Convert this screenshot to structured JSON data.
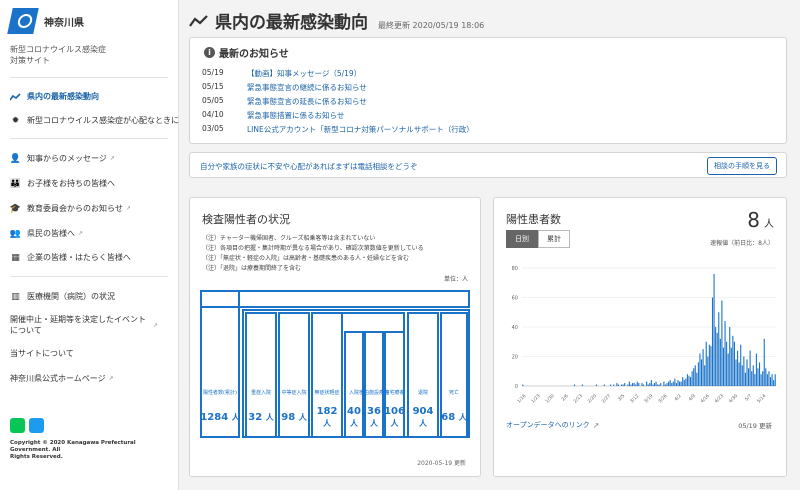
{
  "sidebar": {
    "logo_text": "神奈川県",
    "site_name_line1": "新型コロナウイルス感染症",
    "site_name_line2": "対策サイト",
    "nav_primary": [
      {
        "label": "県内の最新感染動向",
        "icon": "trend-icon",
        "active": true
      },
      {
        "label": "新型コロナウイルス感染症が心配なときに",
        "icon": "virus-icon",
        "active": false
      }
    ],
    "nav_secondary": [
      {
        "label": "知事からのメッセージ",
        "icon": "person-icon",
        "external": true
      },
      {
        "label": "お子様をお持ちの皆様へ",
        "icon": "family-icon",
        "external": false
      },
      {
        "label": "教育委員会からのお知らせ",
        "icon": "graduation-cap-icon",
        "external": true
      },
      {
        "label": "県民の皆様へ",
        "icon": "group-icon",
        "external": true
      },
      {
        "label": "企業の皆様・はたらく皆様へ",
        "icon": "building-icon",
        "external": false
      }
    ],
    "nav_tertiary": [
      {
        "label": "医療機関（病院）の状況",
        "icon": "hospital-icon",
        "external": false
      },
      {
        "label": "開催中止・延期等を決定したイベントについて",
        "icon": "",
        "external": true
      },
      {
        "label": "当サイトについて",
        "icon": "",
        "external": false
      },
      {
        "label": "神奈川県公式ホームページ",
        "icon": "",
        "external": true
      }
    ],
    "copyright_line1": "Copyright © 2020 Kanagawa Prefectural Government. All",
    "copyright_line2": "Rights Reserved."
  },
  "header": {
    "title": "県内の最新感染動向",
    "updated": "最終更新 2020/05/19 18:06"
  },
  "news": {
    "heading": "最新のお知らせ",
    "items": [
      {
        "date": "05/19",
        "text": "【動画】知事メッセージ（5/19）"
      },
      {
        "date": "05/15",
        "text": "緊急事態宣言の継続に係るお知らせ"
      },
      {
        "date": "05/05",
        "text": "緊急事態宣言の延長に係るお知らせ"
      },
      {
        "date": "04/10",
        "text": "緊急事態措置に係るお知らせ"
      },
      {
        "date": "03/05",
        "text": "LINE公式アカウント「新型コロナ対策パーソナルサポート（行政）"
      }
    ]
  },
  "consult": {
    "text": "自分や家族の症状に不安や心配があればまずは電話相談をどうぞ",
    "button": "相談の手順を見る"
  },
  "inspection": {
    "title": "検査陽性者の状況",
    "notes": [
      "（注）チャーター機帰国者、クルーズ船乗客等は含まれていない",
      "（注）各項目の把握・集計時期が異なる場合があり、確認次第数値を更新している",
      "（注）「無症状・軽症の入院」は高齢者・基礎疾患のある人・妊婦などを含む",
      "（注）「退院」は療養期間終了を含む"
    ],
    "unit": "単位：人",
    "boxes": [
      {
        "label": "陽性者数(累計)",
        "value": "1284",
        "unit": "人"
      },
      {
        "label": "重症入院",
        "value": "32",
        "unit": "人"
      },
      {
        "label": "中等症入院",
        "value": "98",
        "unit": "人"
      },
      {
        "label": "無症状軽症",
        "value": "182",
        "unit": "人"
      },
      {
        "label": "入院",
        "value": "40",
        "unit": "人"
      },
      {
        "label": "宿泊施設療養",
        "value": "36",
        "unit": "人"
      },
      {
        "label": "自宅療養",
        "value": "106",
        "unit": "人"
      },
      {
        "label": "退院",
        "value": "904",
        "unit": "人"
      },
      {
        "label": "死亡",
        "value": "68",
        "unit": "人"
      }
    ],
    "updated": "2020-05-19 更新"
  },
  "positive": {
    "title": "陽性患者数",
    "count": "8",
    "count_unit": "人",
    "tab_daily": "日別",
    "tab_cumulative": "累計",
    "preliminary": "速報値（前日比：8人）",
    "open_data": "オープンデータへのリンク",
    "date": "05/19 更新"
  },
  "chart_data": {
    "type": "bar",
    "ylim": [
      0,
      80
    ],
    "yticks": [
      0,
      20,
      40,
      60,
      80
    ],
    "xtick_labels": [
      "1/16",
      "1/23",
      "1/30",
      "2/6",
      "2/13",
      "2/20",
      "2/27",
      "3/5",
      "3/12",
      "3/19",
      "3/26",
      "4/2",
      "4/9",
      "4/16",
      "4/23",
      "4/30",
      "5/7",
      "5/14"
    ],
    "start_label": "1/16",
    "values": [
      1,
      0,
      0,
      0,
      0,
      0,
      0,
      0,
      0,
      0,
      0,
      0,
      0,
      0,
      0,
      0,
      0,
      0,
      0,
      0,
      0,
      0,
      0,
      0,
      0,
      0,
      0,
      0,
      0,
      0,
      0,
      0,
      0,
      1,
      0,
      0,
      0,
      0,
      1,
      0,
      0,
      0,
      0,
      0,
      0,
      0,
      0,
      1,
      0,
      0,
      0,
      0,
      1,
      0,
      0,
      0,
      1,
      0,
      1,
      0,
      2,
      1,
      0,
      1,
      1,
      2,
      0,
      1,
      3,
      1,
      2,
      2,
      1,
      3,
      2,
      0,
      2,
      1,
      0,
      3,
      1,
      2,
      4,
      1,
      2,
      3,
      1,
      1,
      2,
      0,
      3,
      1,
      2,
      3,
      4,
      2,
      3,
      5,
      2,
      4,
      3,
      3,
      6,
      4,
      5,
      8,
      7,
      6,
      10,
      12,
      14,
      9,
      16,
      22,
      18,
      25,
      14,
      30,
      20,
      28,
      27,
      60,
      76,
      40,
      36,
      50,
      32,
      58,
      26,
      44,
      30,
      22,
      40,
      26,
      34,
      30,
      18,
      24,
      16,
      28,
      14,
      20,
      9,
      18,
      12,
      24,
      10,
      14,
      8,
      22,
      12,
      16,
      8,
      10,
      32,
      12,
      8,
      10,
      6,
      8,
      4,
      8
    ]
  }
}
